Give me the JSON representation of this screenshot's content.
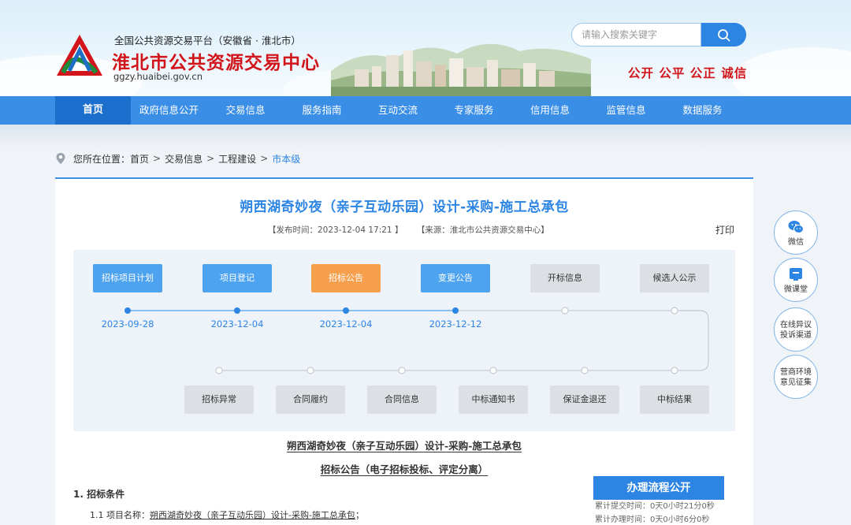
{
  "header": {
    "platform": "全国公共资源交易平台（安徽省 · 淮北市）",
    "title": "淮北市公共资源交易中心",
    "domain": "ggzy.huaibei.gov.cn",
    "search_placeholder": "请输入搜索关键字",
    "slogan": "公开 公平 公正 诚信"
  },
  "nav": {
    "items": [
      "首页",
      "政府信息公开",
      "交易信息",
      "服务指南",
      "互动交流",
      "专家服务",
      "信用信息",
      "监管信息",
      "数据服务"
    ],
    "active": "首页"
  },
  "breadcrumb": {
    "prefix": "您所在位置：",
    "items": [
      "首页",
      "交易信息",
      "工程建设"
    ],
    "current": "市本级"
  },
  "article": {
    "title": "朔西湖奇妙夜（亲子互动乐园）设计-采购-施工总承包",
    "publish_time": "【发布时间：2023-12-04 17:21 】",
    "source": "【来源：淮北市公共资源交易中心】",
    "print": "打印"
  },
  "flow": {
    "top_steps": [
      {
        "label": "招标项目计划",
        "state": "done",
        "date": "2023-09-28"
      },
      {
        "label": "项目登记",
        "state": "done",
        "date": "2023-12-04"
      },
      {
        "label": "招标公告",
        "state": "current",
        "date": "2023-12-04"
      },
      {
        "label": "变更公告",
        "state": "done",
        "date": "2023-12-12"
      },
      {
        "label": "开标信息",
        "state": "pending",
        "date": ""
      },
      {
        "label": "候选人公示",
        "state": "pending",
        "date": ""
      }
    ],
    "bottom_steps": [
      "招标异常",
      "合同履约",
      "合同信息",
      "中标通知书",
      "保证金退还",
      "中标结果"
    ],
    "colors": {
      "done": "#4da3ef",
      "current": "#f6a04d",
      "pending": "#dcdfe4"
    }
  },
  "document": {
    "heading": "朔西湖奇妙夜（亲子互动乐园）设计-采购-施工总承包",
    "subheading": "招标公告（电子招标投标、评定分离）",
    "section": "1. 招标条件",
    "line_label": "1.1 项目名称：",
    "line_value": "朔西湖奇妙夜（亲子互动乐园）设计-采购-施工总承包",
    "line_end": "；"
  },
  "process": {
    "title": "办理流程公开",
    "rows": [
      "累计提交时间：0天0小时21分0秒",
      "累计办理时间：0天0小时6分0秒"
    ]
  },
  "float": {
    "items": [
      {
        "icon": "wechat-icon",
        "label": "微信"
      },
      {
        "icon": "classroom-icon",
        "label": "微课堂"
      },
      {
        "icon": "",
        "label": "在线异议\n投诉渠道"
      },
      {
        "icon": "",
        "label": "营商环境\n意见征集"
      }
    ]
  }
}
